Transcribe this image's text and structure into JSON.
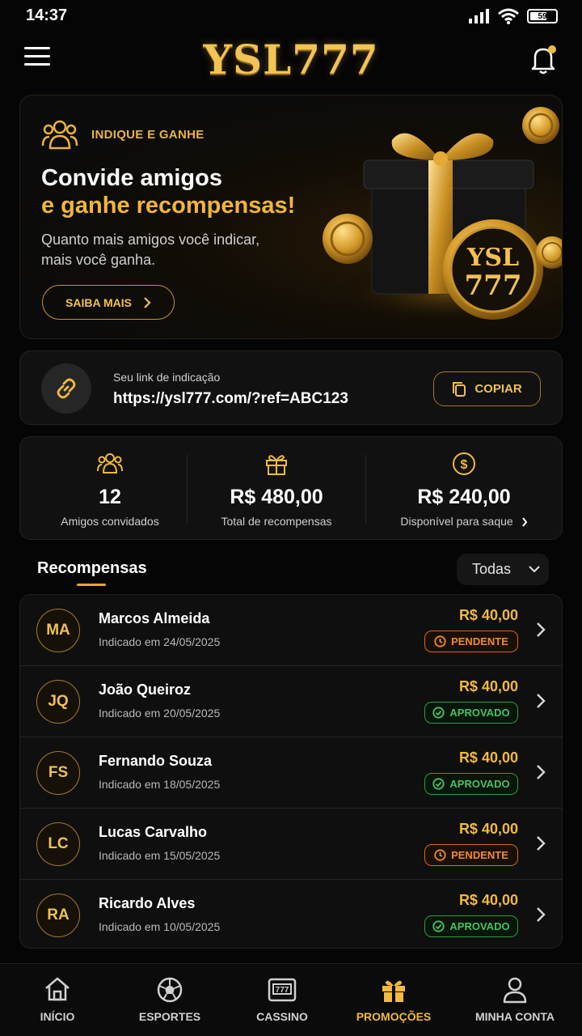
{
  "status": {
    "time": "14:37",
    "battery": "59"
  },
  "header": {
    "brand": "YSL777"
  },
  "hero": {
    "tag": "INDIQUE E GANHE",
    "title_line1": "Convide amigos",
    "title_line2": "e ganhe recompensas!",
    "subtitle": "Quanto mais amigos você indicar, mais você ganha.",
    "button": "SAIBA MAIS",
    "coin_text_top": "YSL",
    "coin_text_bottom": "777"
  },
  "referral": {
    "label": "Seu link de indicação",
    "url": "https://ysl777.com/?ref=ABC123",
    "copy_button": "COPIAR"
  },
  "stats": [
    {
      "value": "12",
      "label": "Amigos convidados"
    },
    {
      "value": "R$ 480,00",
      "label": "Total de recompensas"
    },
    {
      "value": "R$ 240,00",
      "label": "Disponível para saque"
    }
  ],
  "rewards": {
    "title": "Recompensas",
    "filter": "Todas",
    "items": [
      {
        "initials": "MA",
        "name": "Marcos Almeida",
        "date": "Indicado em 24/05/2025",
        "amount": "R$ 40,00",
        "status": "PENDENTE"
      },
      {
        "initials": "JQ",
        "name": "João Queiroz",
        "date": "Indicado em 20/05/2025",
        "amount": "R$ 40,00",
        "status": "APROVADO"
      },
      {
        "initials": "FS",
        "name": "Fernando Souza",
        "date": "Indicado em 18/05/2025",
        "amount": "R$ 40,00",
        "status": "APROVADO"
      },
      {
        "initials": "LC",
        "name": "Lucas Carvalho",
        "date": "Indicado em 15/05/2025",
        "amount": "R$ 40,00",
        "status": "PENDENTE"
      },
      {
        "initials": "RA",
        "name": "Ricardo Alves",
        "date": "Indicado em 10/05/2025",
        "amount": "R$ 40,00",
        "status": "APROVADO"
      }
    ]
  },
  "nav": [
    {
      "label": "INÍCIO",
      "icon": "home-icon"
    },
    {
      "label": "ESPORTES",
      "icon": "soccer-ball-icon"
    },
    {
      "label": "CASSINO",
      "icon": "slot-machine-icon"
    },
    {
      "label": "PROMOÇÕES",
      "icon": "gift-icon",
      "active": true
    },
    {
      "label": "MINHA CONTA",
      "icon": "user-icon"
    }
  ],
  "colors": {
    "accent": "#f0b940",
    "pending": "#f08a2e",
    "approved": "#47c063",
    "background": "#050505"
  }
}
